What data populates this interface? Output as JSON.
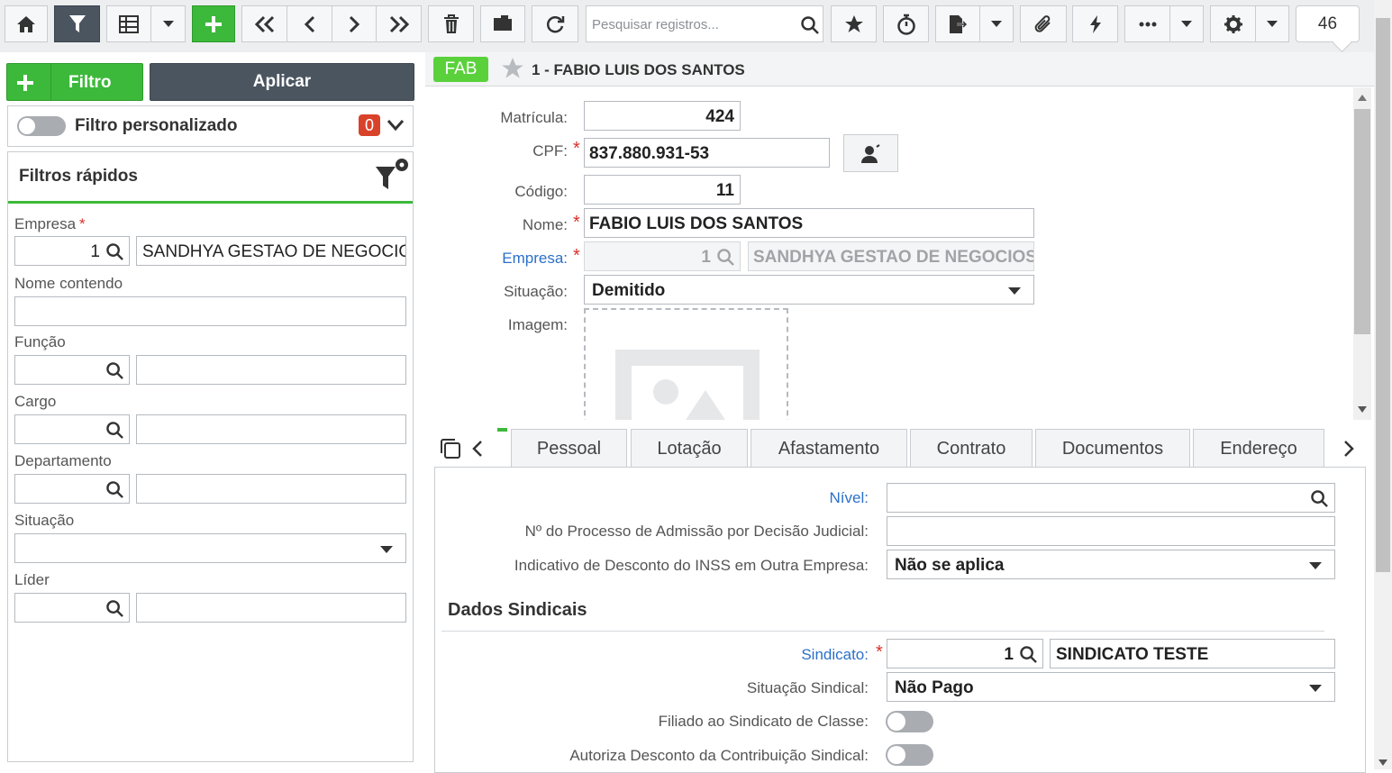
{
  "toolbar": {
    "search_placeholder": "Pesquisar registros...",
    "record_count": "46"
  },
  "filter_panel": {
    "filter_button_label": "Filtro",
    "apply_button_label": "Aplicar",
    "custom_filter_label": "Filtro personalizado",
    "custom_filter_count": "0",
    "quick_filters_title": "Filtros rápidos",
    "fields": {
      "empresa_label": "Empresa",
      "empresa_code": "1",
      "empresa_name": "SANDHYA GESTAO DE NEGOCIOS",
      "nome_label": "Nome contendo",
      "funcao_label": "Função",
      "cargo_label": "Cargo",
      "departamento_label": "Departamento",
      "situacao_label": "Situação",
      "lider_label": "Líder"
    }
  },
  "record": {
    "badge": "FAB",
    "title": "1 - FABIO LUIS DOS SANTOS",
    "matricula_label": "Matrícula:",
    "matricula": "424",
    "cpf_label": "CPF:",
    "cpf": "837.880.931-53",
    "codigo_label": "Código:",
    "codigo": "11",
    "nome_label": "Nome:",
    "nome": "FABIO LUIS DOS SANTOS",
    "empresa_label": "Empresa:",
    "empresa_code": "1",
    "empresa_name": "SANDHYA GESTAO DE NEGOCIOS",
    "situacao_label": "Situação:",
    "situacao": "Demitido",
    "imagem_label": "Imagem:"
  },
  "tabs": [
    "Pessoal",
    "Lotação",
    "Afastamento",
    "Contrato",
    "Documentos",
    "Endereço"
  ],
  "contrato": {
    "nivel_label": "Nível:",
    "processo_label": "Nº do Processo de Admissão por Decisão Judicial:",
    "inss_label": "Indicativo de Desconto do INSS em Outra Empresa:",
    "inss_value": "Não se aplica",
    "section_title": "Dados Sindicais",
    "sindicato_label": "Sindicato:",
    "sindicato_code": "1",
    "sindicato_name": "SINDICATO TESTE",
    "situacao_sindical_label": "Situação Sindical:",
    "situacao_sindical": "Não Pago",
    "filiado_label": "Filiado ao Sindicato de Classe:",
    "autoriza_label": "Autoriza Desconto da Contribuição Sindical:"
  },
  "colors": {
    "accent_green": "#3cb93a",
    "toolbar_dark": "#4a5560",
    "required_red": "#d9322a",
    "link_blue": "#2b70c9",
    "badge_red": "#d9422a"
  }
}
